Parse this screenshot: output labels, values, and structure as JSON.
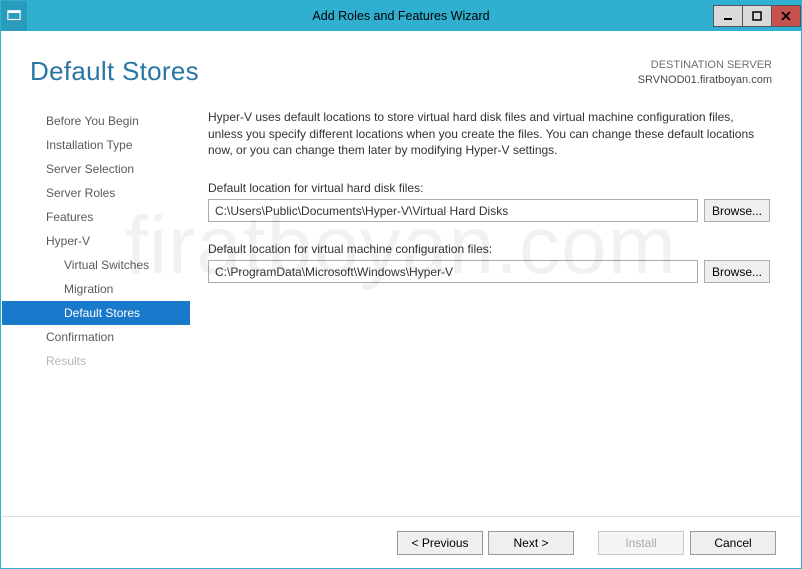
{
  "window": {
    "title": "Add Roles and Features Wizard"
  },
  "destination": {
    "label": "DESTINATION SERVER",
    "name": "SRVNOD01.firatboyan.com"
  },
  "page_title": "Default Stores",
  "sidebar": {
    "items": [
      {
        "label": "Before You Begin",
        "sub": false,
        "selected": false,
        "disabled": false
      },
      {
        "label": "Installation Type",
        "sub": false,
        "selected": false,
        "disabled": false
      },
      {
        "label": "Server Selection",
        "sub": false,
        "selected": false,
        "disabled": false
      },
      {
        "label": "Server Roles",
        "sub": false,
        "selected": false,
        "disabled": false
      },
      {
        "label": "Features",
        "sub": false,
        "selected": false,
        "disabled": false
      },
      {
        "label": "Hyper-V",
        "sub": false,
        "selected": false,
        "disabled": false
      },
      {
        "label": "Virtual Switches",
        "sub": true,
        "selected": false,
        "disabled": false
      },
      {
        "label": "Migration",
        "sub": true,
        "selected": false,
        "disabled": false
      },
      {
        "label": "Default Stores",
        "sub": true,
        "selected": true,
        "disabled": false
      },
      {
        "label": "Confirmation",
        "sub": false,
        "selected": false,
        "disabled": false
      },
      {
        "label": "Results",
        "sub": false,
        "selected": false,
        "disabled": true
      }
    ]
  },
  "content": {
    "intro": "Hyper-V uses default locations to store virtual hard disk files and virtual machine configuration files, unless you specify different locations when you create the files. You can change these default locations now, or you can change them later by modifying Hyper-V settings.",
    "vhd_label": "Default location for virtual hard disk files:",
    "vhd_value": "C:\\Users\\Public\\Documents\\Hyper-V\\Virtual Hard Disks",
    "vmcfg_label": "Default location for virtual machine configuration files:",
    "vmcfg_value": "C:\\ProgramData\\Microsoft\\Windows\\Hyper-V",
    "browse_label": "Browse..."
  },
  "footer": {
    "previous": "< Previous",
    "next": "Next >",
    "install": "Install",
    "cancel": "Cancel"
  },
  "watermark": "firatboyan.com"
}
